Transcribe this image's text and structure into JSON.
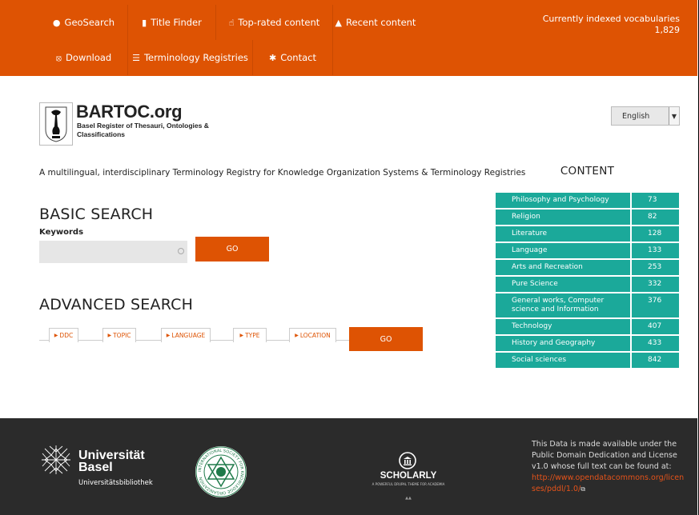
{
  "nav": {
    "row1": [
      {
        "label": "GeoSearch",
        "icon": "globe-icon"
      },
      {
        "label": "Title Finder",
        "icon": "file-icon"
      },
      {
        "label": "Top-rated content",
        "icon": "thumbs-up-icon"
      },
      {
        "label": "Recent content",
        "icon": "bell-icon"
      }
    ],
    "row2": [
      {
        "label": "Download",
        "icon": "download-icon"
      },
      {
        "label": "Terminology Registries",
        "icon": "list-icon"
      },
      {
        "label": "Contact",
        "icon": "asterisk-icon"
      }
    ]
  },
  "indexed": {
    "label": "Currently indexed vocabularies",
    "count": "1,829"
  },
  "header": {
    "brand": "BARTOC.org",
    "subtitle": "Basel Register of Thesauri, Ontologies & Classifications",
    "language": "English"
  },
  "tagline": "A multilingual, interdisciplinary Terminology Registry for Knowledge Organization Systems & Terminology Registries",
  "basic_search": {
    "title": "BASIC SEARCH",
    "keywords_label": "Keywords",
    "keywords_value": "",
    "go_label": "GO"
  },
  "advanced_search": {
    "title": "ADVANCED SEARCH",
    "filters": [
      "DDC",
      "TOPIC",
      "LANGUAGE",
      "TYPE",
      "LOCATION"
    ],
    "go_label": "GO"
  },
  "content": {
    "title": "CONTENT",
    "categories": [
      {
        "name": "Philosophy and Psychology",
        "count": "73"
      },
      {
        "name": "Religion",
        "count": "82"
      },
      {
        "name": "Literature",
        "count": "128"
      },
      {
        "name": "Language",
        "count": "133"
      },
      {
        "name": "Arts and Recreation",
        "count": "253"
      },
      {
        "name": "Pure Science",
        "count": "332"
      },
      {
        "name": "General works, Computer science and Information",
        "count": "376"
      },
      {
        "name": "Technology",
        "count": "407"
      },
      {
        "name": "History and Geography",
        "count": "433"
      },
      {
        "name": "Social sciences",
        "count": "842"
      }
    ]
  },
  "footer": {
    "unibas_name_1": "Universität",
    "unibas_name_2": "Basel",
    "unibas_sub": "Universitätsbibliothek",
    "isko_text": "INTERNATIONAL SOCIETY FOR KNOWLEDGE ORGANIZATION",
    "scholarly_title": "SCHOLARLY",
    "scholarly_sub": "A POWERFUL DRUPAL THEME FOR ACADEMIA",
    "license_text": "This Data is made available under the Public Domain Dedication and License v1.0 whose full text can be found at:",
    "license_link": "http://www.opendatacommons.org/licenses/pddl/1.0/"
  },
  "colors": {
    "accent": "#de5303",
    "teal": "#1ba99a",
    "footer_bg": "#2b2b2b"
  }
}
